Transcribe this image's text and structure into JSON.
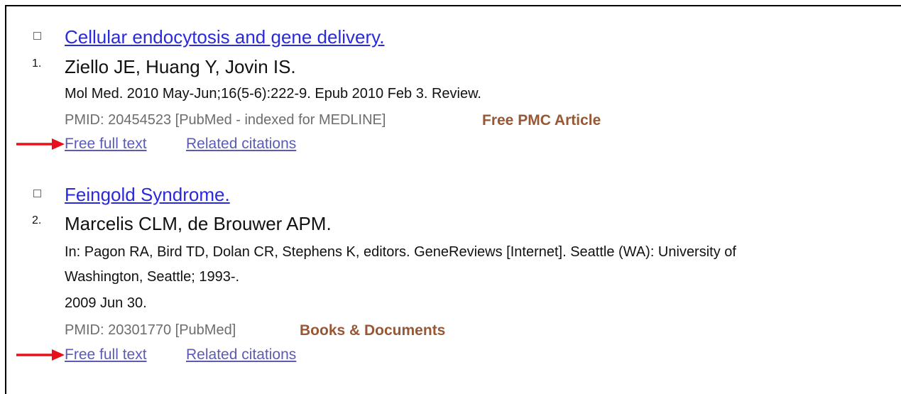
{
  "results": [
    {
      "number": "1.",
      "title": "Cellular endocytosis and gene delivery.",
      "authors": "Ziello JE, Huang Y, Jovin IS.",
      "citation_lines": [
        "Mol Med. 2010 May-Jun;16(5-6):222-9. Epub 2010 Feb 3. Review."
      ],
      "pmid": "PMID: 20454523 [PubMed - indexed for MEDLINE]",
      "badge": "Free PMC Article",
      "links": {
        "full_text": "Free full text",
        "related": "Related citations"
      }
    },
    {
      "number": "2.",
      "title": "Feingold Syndrome.",
      "authors": "Marcelis CLM, de Brouwer APM.",
      "citation_lines": [
        "In: Pagon RA, Bird TD, Dolan CR, Stephens K, editors. GeneReviews [Internet]. Seattle (WA): University of",
        "Washington, Seattle; 1993-.",
        "2009 Jun 30."
      ],
      "pmid": "PMID: 20301770 [PubMed]",
      "badge": "Books & Documents",
      "links": {
        "full_text": "Free full text",
        "related": "Related citations"
      }
    }
  ],
  "colors": {
    "title_link": "#2a2adc",
    "secondary_link": "#5b5bb6",
    "badge": "#985735",
    "pmid_text": "#6d6d6d",
    "arrow": "#e8101a"
  },
  "icons": {
    "arrow": "red-right-arrow-icon",
    "checkbox": "checkbox-icon"
  }
}
